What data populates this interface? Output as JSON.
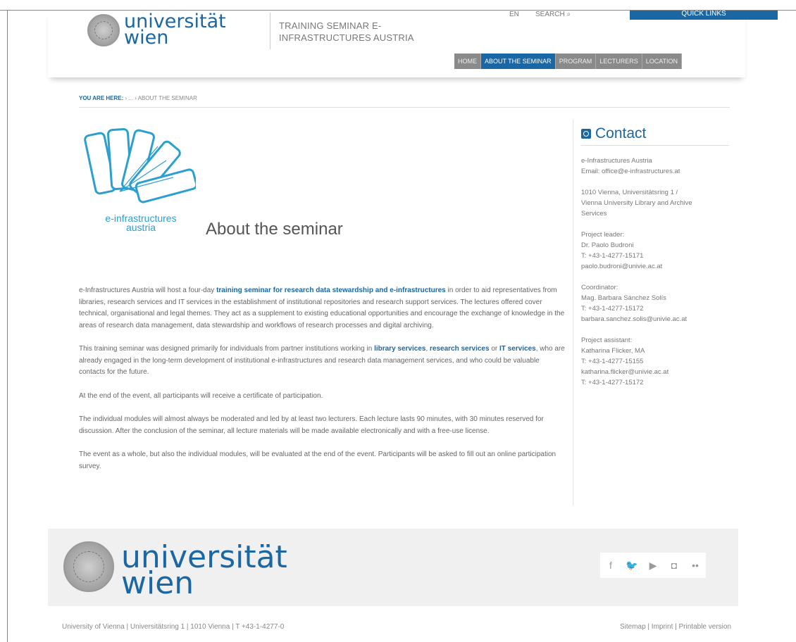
{
  "header": {
    "logo_line1": "universität",
    "logo_line2": "wien",
    "site_title": "TRAINING SEMINAR E-INFRASTRUCTURES AUSTRIA",
    "lang": "EN",
    "search": "SEARCH",
    "quick_links": "QUICK LINKS"
  },
  "nav": [
    {
      "label": "HOME",
      "active": false
    },
    {
      "label": "ABOUT THE SEMINAR",
      "active": true
    },
    {
      "label": "PROGRAM",
      "active": false
    },
    {
      "label": "LECTURERS",
      "active": false
    },
    {
      "label": "LOCATION",
      "active": false
    }
  ],
  "breadcrumb": {
    "prefix": "YOU ARE HERE:",
    "trail": " › ... › ABOUT THE SEMINAR"
  },
  "main": {
    "logo_text_line1": "e-infrastructures",
    "logo_text_line2": "austria",
    "title": "About the seminar",
    "p1_a": "e-Infrastructures Austria will host a four-day ",
    "p1_link": "training seminar for research data stewardship and e-infrastructures",
    "p1_b": " in order to aid representatives from libraries, research services and IT services in the establishment of institutional repositories and research support services. The lectures offered cover technical, organisational and legal themes. They act as a supplement to existing educational opportunities and encourage the exchange of knowledge in the areas of research data management, data stewardship and workflows of research processes and digital archiving.",
    "p2_a": "This training seminar was designed primarily for individuals from partner institutions working in ",
    "p2_link1": "library services",
    "p2_sep": ", ",
    "p2_link2": "research services",
    "p2_or": " or ",
    "p2_link3": "IT services",
    "p2_b": ", who are already engaged in the long-term development of institutional e-infrastructures and research data management services, and who could be valuable contacts for the future.",
    "p3": "At the end of the event, all participants will receive a certificate of participation.",
    "p4": "The individual modules will almost always be moderated and led by at least two lecturers. Each lecture lasts 90 minutes, with 30 minutes reserved for discussion. After the conclusion of the seminar, all lecture materials will be made available electronically and with a free-use license.",
    "p5": "The event as a whole, but also the individual modules, will be evaluated at the end of the event. Participants will be asked to fill out an online participation survey."
  },
  "sidebar": {
    "title": "Contact",
    "lines": [
      [
        "e-Infrastructures Austria",
        "Email: office@e-infrastructures.at"
      ],
      [
        "1010 Vienna, Universitätsring 1 /",
        "Vienna University Library and Archive",
        "Services"
      ],
      [
        "Project leader:",
        "Dr. Paolo Budroni",
        "T: +43-1-4277-15171",
        "paolo.budroni@univie.ac.at"
      ],
      [
        "Coordinator:",
        "Mag. Barbara Sánchez Solís",
        "T: +43-1-4277-15172",
        "barbara.sanchez.solis@univie.ac.at"
      ],
      [
        "Project assistant:",
        "Katharina Flicker, MA",
        "T: +43-1-4277-15155",
        "katharina.flicker@univie.ac.at",
        "T: +43-1-4277-15172"
      ]
    ]
  },
  "footer": {
    "logo_line1": "universität",
    "logo_line2": "wien",
    "social": [
      {
        "icon": "facebook-icon",
        "glyph": "f"
      },
      {
        "icon": "twitter-icon",
        "glyph": "🐦"
      },
      {
        "icon": "youtube-icon",
        "glyph": "▶"
      },
      {
        "icon": "instagram-icon",
        "glyph": "◘"
      },
      {
        "icon": "flickr-icon",
        "glyph": "••"
      }
    ],
    "address": "University of Vienna | Universitätsring 1 | 1010 Vienna | T +43-1-4277-0",
    "links": "Sitemap | Imprint | Printable version"
  },
  "colors": {
    "accent": "#1a67a3",
    "nav_gray": "#8a8a8a",
    "logo_blue": "#2a9fd0"
  }
}
